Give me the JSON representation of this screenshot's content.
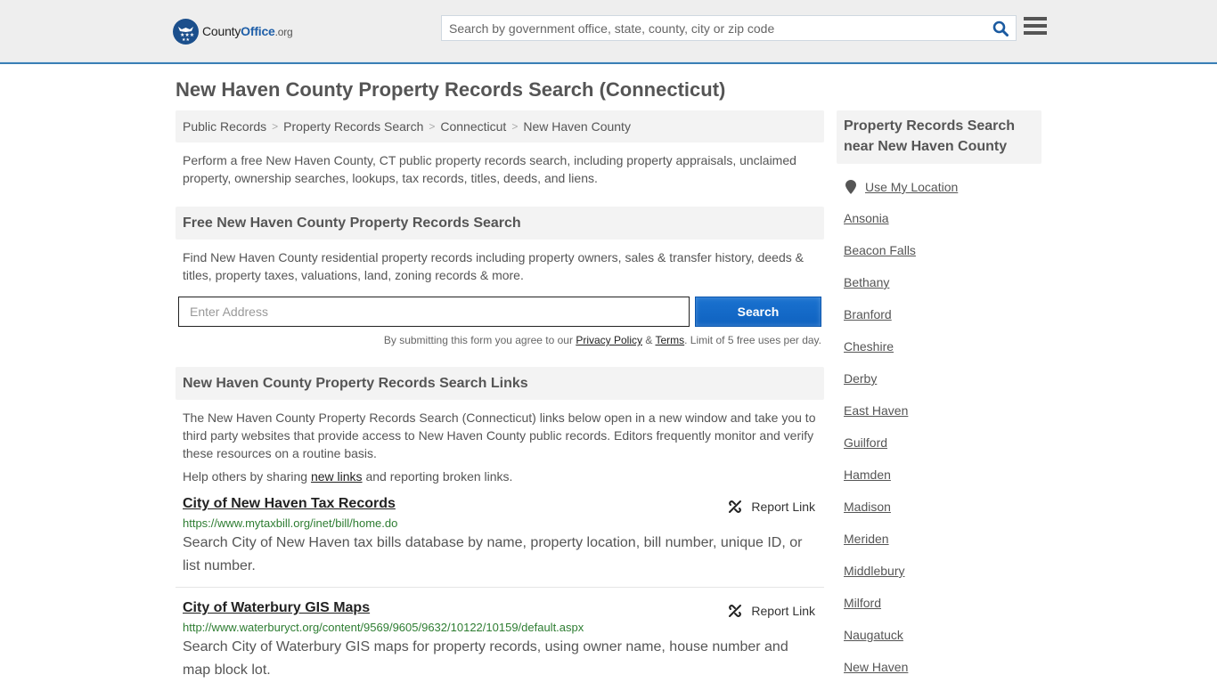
{
  "header": {
    "logo": {
      "part1": "County",
      "part2": "Office",
      "part3": ".org",
      "icon": "eagle-stars-badge-icon"
    },
    "search": {
      "placeholder": "Search by government office, state, county, city or zip code",
      "value": "",
      "icon": "search-icon"
    },
    "menu_icon": "hamburger-menu-icon",
    "colors": {
      "accent_border": "#3a7fb5",
      "brand_blue": "#1b4f8c",
      "search_icon": "#1a5aa0"
    }
  },
  "page": {
    "title": "New Haven County Property Records Search (Connecticut)"
  },
  "breadcrumb": [
    {
      "label": "Public Records"
    },
    {
      "label": "Property Records Search"
    },
    {
      "label": "Connecticut"
    },
    {
      "label": "New Haven County"
    }
  ],
  "breadcrumb_separator": ">",
  "intro": "Perform a free New Haven County, CT public property records search, including property appraisals, unclaimed property, ownership searches, lookups, tax records, titles, deeds, and liens.",
  "free_search": {
    "heading": "Free New Haven County Property Records Search",
    "text": "Find New Haven County residential property records including property owners, sales & transfer history, deeds & titles, property taxes, valuations, land, zoning records & more.",
    "address_placeholder": "Enter Address",
    "address_value": "",
    "button_label": "Search",
    "button_color": "#1468c8",
    "disclaimer": {
      "prefix": "By submitting this form you agree to our ",
      "privacy_label": "Privacy Policy",
      "amp": " & ",
      "terms_label": "Terms",
      "suffix": ". Limit of 5 free uses per day."
    }
  },
  "links_section": {
    "heading": "New Haven County Property Records Search Links",
    "text": "The New Haven County Property Records Search (Connecticut) links below open in a new window and take you to third party websites that provide access to New Haven County public records. Editors frequently monitor and verify these resources on a routine basis.",
    "share": {
      "prefix": "Help others by sharing ",
      "link_label": "new links",
      "suffix": " and reporting broken links."
    },
    "report_label": "Report Link",
    "report_icon": "broken-link-icon",
    "url_color": "#2e7d32",
    "results": [
      {
        "title": "City of New Haven Tax Records",
        "url": "https://www.mytaxbill.org/inet/bill/home.do",
        "description": "Search City of New Haven tax bills database by name, property location, bill number, unique ID, or list number."
      },
      {
        "title": "City of Waterbury GIS Maps",
        "url": "http://www.waterburyct.org/content/9569/9605/9632/10122/10159/default.aspx",
        "description": "Search City of Waterbury GIS maps for property records, using owner name, house number and map block lot."
      }
    ]
  },
  "sidebar": {
    "heading": "Property Records Search near New Haven County",
    "use_location": {
      "label": "Use My Location",
      "icon": "map-pin-icon"
    },
    "places": [
      {
        "label": "Ansonia"
      },
      {
        "label": "Beacon Falls"
      },
      {
        "label": "Bethany"
      },
      {
        "label": "Branford"
      },
      {
        "label": "Cheshire"
      },
      {
        "label": "Derby"
      },
      {
        "label": "East Haven"
      },
      {
        "label": "Guilford"
      },
      {
        "label": "Hamden"
      },
      {
        "label": "Madison"
      },
      {
        "label": "Meriden"
      },
      {
        "label": "Middlebury"
      },
      {
        "label": "Milford"
      },
      {
        "label": "Naugatuck"
      },
      {
        "label": "New Haven"
      }
    ]
  }
}
